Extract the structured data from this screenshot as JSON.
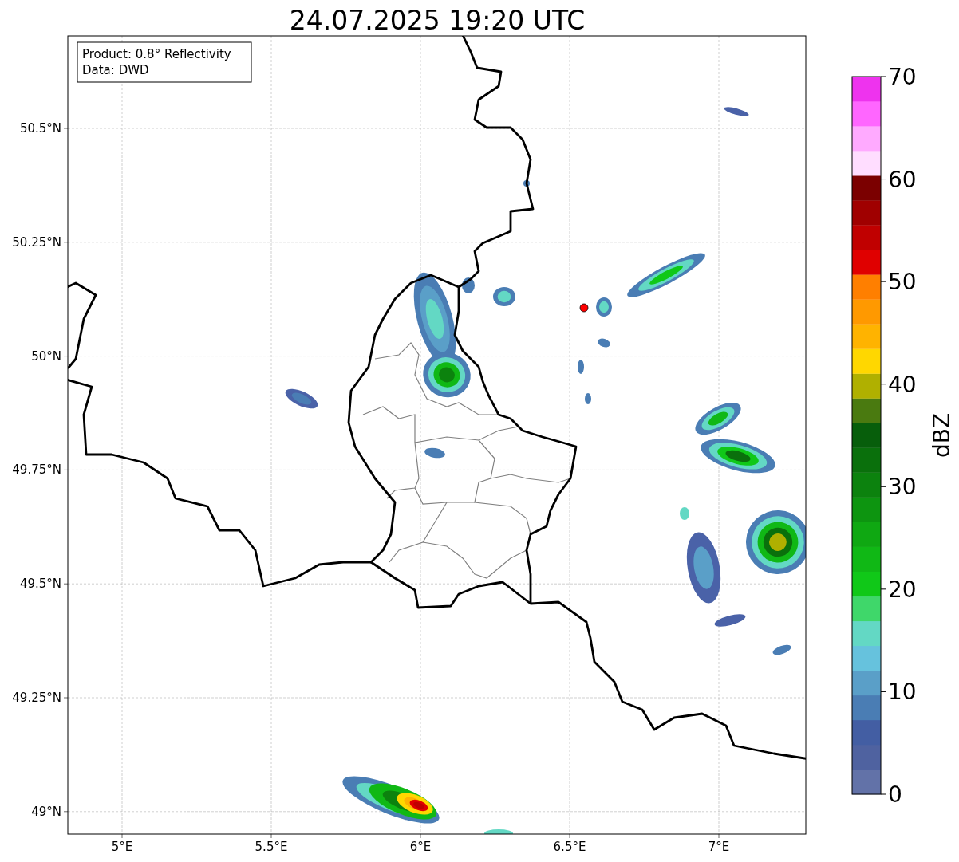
{
  "title": "24.07.2025 19:20 UTC",
  "info_box": {
    "lines": [
      "Product: 0.8° Reflectivity",
      "Data: DWD"
    ]
  },
  "lat_ticks": [
    "50.5°N",
    "50.25°N",
    "50°N",
    "49.75°N",
    "49.5°N",
    "49.25°N",
    "49°N"
  ],
  "lon_ticks": [
    "5°E",
    "5.5°E",
    "6°E",
    "6.5°E",
    "7°E"
  ],
  "colorbar": {
    "label": "dBZ",
    "ticks": [
      "70",
      "60",
      "50",
      "40",
      "30",
      "20",
      "10",
      "0"
    ],
    "segments": [
      {
        "color": "#6272a8"
      },
      {
        "color": "#4f62a0"
      },
      {
        "color": "#435ea3"
      },
      {
        "color": "#4a7db4"
      },
      {
        "color": "#5a9fc8"
      },
      {
        "color": "#66c2dd"
      },
      {
        "color": "#63d8c4"
      },
      {
        "color": "#3fd76a"
      },
      {
        "color": "#10c818"
      },
      {
        "color": "#10b815"
      },
      {
        "color": "#0fa812"
      },
      {
        "color": "#0d9510"
      },
      {
        "color": "#0c820e"
      },
      {
        "color": "#0a700c"
      },
      {
        "color": "#075e0b"
      },
      {
        "color": "#4a7a10"
      },
      {
        "color": "#b0b000"
      },
      {
        "color": "#ffd700"
      },
      {
        "color": "#ffb300"
      },
      {
        "color": "#ff9900"
      },
      {
        "color": "#ff7f00"
      },
      {
        "color": "#e00000"
      },
      {
        "color": "#c00000"
      },
      {
        "color": "#a00000"
      },
      {
        "color": "#7b0000"
      },
      {
        "color": "#ffddff"
      },
      {
        "color": "#ffaaff"
      },
      {
        "color": "#ff66ff"
      },
      {
        "color": "#ee33ee"
      }
    ]
  }
}
